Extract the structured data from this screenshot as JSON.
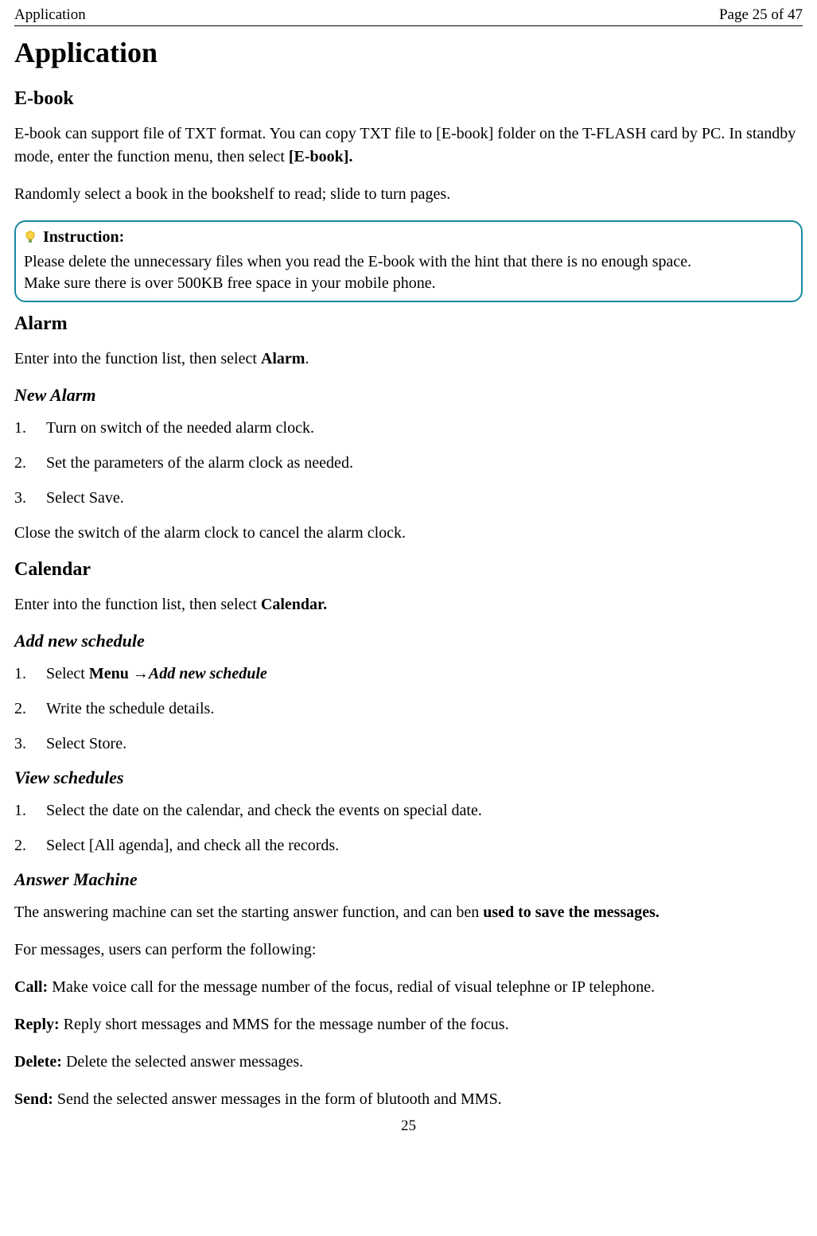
{
  "header": {
    "left": "Application",
    "right": "Page 25 of 47"
  },
  "title": "Application",
  "ebook": {
    "heading": "E-book",
    "p1_before": "E-book can support file of TXT format. You can copy TXT file to [E-book] folder on the T-FLASH card by PC. In standby mode, enter the function menu, then select ",
    "p1_bold": "[E-book].",
    "p2": "Randomly select a book in the bookshelf to read; slide to turn pages."
  },
  "instruction": {
    "title": "Instruction:",
    "line1": "Please delete the unnecessary files when you read the E-book with the hint that there is no enough space.",
    "line2": "Make sure there is over 500KB free space in your mobile phone."
  },
  "alarm": {
    "heading": "Alarm",
    "p1_before": "Enter into the function list, then select ",
    "p1_bold": "Alarm",
    "p1_after": ".",
    "newAlarmHeading": "New Alarm",
    "steps": [
      "Turn on switch of the needed alarm clock.",
      "Set the parameters of the alarm clock as needed.",
      "Select Save."
    ],
    "close": "Close the switch of the alarm clock to cancel the alarm clock."
  },
  "calendar": {
    "heading": "Calendar",
    "p1_before": "Enter into the function list, then select ",
    "p1_bold": "Calendar.",
    "addHeading": "Add new schedule",
    "addSteps": {
      "s1_before": "Select ",
      "s1_bold1": "Menu ",
      "s1_arrow": "→",
      "s1_bolditalic": "Add new schedule",
      "s2": "Write the schedule details.",
      "s3": "Select Store."
    },
    "viewHeading": "View schedules",
    "viewSteps": [
      "Select the date on the calendar, and check the events on special date.",
      "Select [All agenda], and check all the records."
    ]
  },
  "answerMachine": {
    "heading": "Answer Machine",
    "p1_before": "The answering machine can set the starting answer function, and can ben ",
    "p1_bold": "used to save the messages.",
    "p2": "For messages, users can perform the following:",
    "call_label": "Call:",
    "call_text": " Make voice call for the message number of the focus, redial of visual telephne or IP telephone.",
    "reply_label": "Reply:",
    "reply_text": " Reply short messages and MMS for the message number of the focus.",
    "delete_label": "Delete:",
    "delete_text": " Delete the selected answer messages.",
    "send_label": "Send:",
    "send_text": " Send the selected answer messages in the form of blutooth and MMS."
  },
  "footer": "25"
}
